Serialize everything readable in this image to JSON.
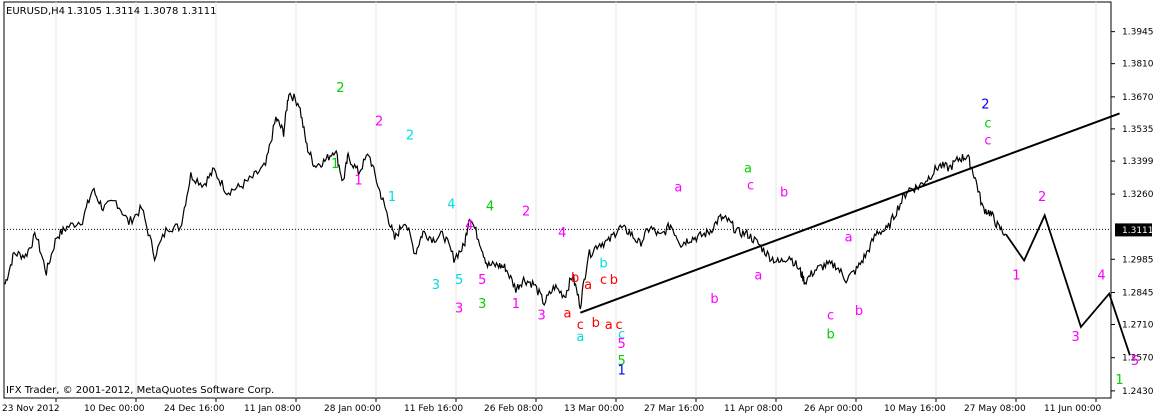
{
  "chart_data": {
    "type": "line",
    "header": {
      "symbol": "EURUSD,H4",
      "ohlc": "1.3105 1.3114 1.3078 1.3111"
    },
    "copyright": "IFX Trader, © 2001-2012, MetaQuotes Software Corp.",
    "current_price_label": "1.3111",
    "current_price": 1.3111,
    "ylim": [
      1.24,
      1.407
    ],
    "y_ticks": [
      "1.3945",
      "1.3810",
      "1.3670",
      "1.3535",
      "1.3399",
      "1.3260",
      "1.2985",
      "1.2845",
      "1.2710",
      "1.2570",
      "1.2430"
    ],
    "x_ticks": [
      "23 Nov 2012",
      "10 Dec 00:00",
      "24 Dec 16:00",
      "11 Jan 08:00",
      "28 Jan 00:00",
      "11 Feb 16:00",
      "26 Feb 08:00",
      "13 Mar 00:00",
      "27 Mar 16:00",
      "11 Apr 08:00",
      "26 Apr 00:00",
      "10 May 16:00",
      "27 May 08:00",
      "11 Jun 00:00"
    ],
    "x_count": 13.7,
    "price_path": [
      [
        0,
        1.288
      ],
      [
        0.35,
        1.301
      ],
      [
        0.8,
        1.3
      ],
      [
        1.2,
        1.309
      ],
      [
        1.6,
        1.293
      ],
      [
        2.0,
        1.308
      ],
      [
        2.4,
        1.312
      ],
      [
        3.0,
        1.315
      ],
      [
        3.4,
        1.328
      ],
      [
        3.8,
        1.32
      ],
      [
        4.3,
        1.323
      ],
      [
        4.8,
        1.314
      ],
      [
        5.3,
        1.32
      ],
      [
        5.8,
        1.3
      ],
      [
        6.3,
        1.312
      ],
      [
        6.8,
        1.312
      ],
      [
        7.2,
        1.334
      ],
      [
        7.7,
        1.33
      ],
      [
        8.1,
        1.336
      ],
      [
        8.6,
        1.327
      ],
      [
        9.1,
        1.329
      ],
      [
        9.6,
        1.333
      ],
      [
        10.1,
        1.338
      ],
      [
        10.5,
        1.358
      ],
      [
        10.8,
        1.352
      ],
      [
        11.0,
        1.369
      ],
      [
        11.4,
        1.364
      ],
      [
        11.7,
        1.346
      ],
      [
        12.0,
        1.338
      ],
      [
        12.4,
        1.34
      ],
      [
        12.8,
        1.345
      ],
      [
        13.1,
        1.331
      ],
      [
        13.3,
        1.342
      ],
      [
        13.7,
        1.335
      ],
      [
        14.1,
        1.343
      ],
      [
        14.5,
        1.328
      ],
      [
        14.8,
        1.318
      ],
      [
        15.1,
        1.307
      ],
      [
        15.5,
        1.315
      ],
      [
        15.9,
        1.301
      ],
      [
        16.2,
        1.31
      ],
      [
        16.6,
        1.307
      ],
      [
        17.0,
        1.309
      ],
      [
        17.4,
        1.299
      ],
      [
        17.8,
        1.304
      ],
      [
        18.0,
        1.317
      ],
      [
        18.4,
        1.306
      ],
      [
        18.7,
        1.296
      ],
      [
        19.1,
        1.296
      ],
      [
        19.4,
        1.295
      ],
      [
        19.8,
        1.286
      ],
      [
        20.1,
        1.29
      ],
      [
        20.5,
        1.288
      ],
      [
        20.9,
        1.28
      ],
      [
        21.3,
        1.287
      ],
      [
        21.7,
        1.283
      ],
      [
        22.0,
        1.292
      ],
      [
        22.3,
        1.279
      ],
      [
        22.6,
        1.3
      ],
      [
        23.0,
        1.305
      ],
      [
        23.4,
        1.306
      ],
      [
        23.8,
        1.312
      ],
      [
        24.2,
        1.31
      ],
      [
        24.6,
        1.305
      ],
      [
        25.0,
        1.312
      ],
      [
        25.4,
        1.308
      ],
      [
        25.8,
        1.313
      ],
      [
        26.2,
        1.305
      ],
      [
        26.5,
        1.307
      ],
      [
        26.9,
        1.308
      ],
      [
        27.3,
        1.31
      ],
      [
        27.7,
        1.316
      ],
      [
        28.0,
        1.315
      ],
      [
        28.4,
        1.31
      ],
      [
        28.8,
        1.309
      ],
      [
        29.2,
        1.305
      ],
      [
        29.6,
        1.3
      ],
      [
        30.0,
        1.297
      ],
      [
        30.4,
        1.3
      ],
      [
        30.8,
        1.294
      ],
      [
        31.0,
        1.289
      ],
      [
        31.4,
        1.294
      ],
      [
        31.8,
        1.296
      ],
      [
        32.2,
        1.296
      ],
      [
        32.6,
        1.29
      ],
      [
        33.0,
        1.294
      ],
      [
        33.4,
        1.301
      ],
      [
        33.8,
        1.31
      ],
      [
        34.2,
        1.311
      ],
      [
        34.6,
        1.32
      ],
      [
        35.0,
        1.328
      ],
      [
        35.4,
        1.329
      ],
      [
        35.8,
        1.333
      ],
      [
        36.2,
        1.338
      ],
      [
        36.6,
        1.337
      ],
      [
        37.0,
        1.341
      ],
      [
        37.3,
        1.342
      ],
      [
        37.6,
        1.333
      ],
      [
        37.9,
        1.32
      ],
      [
        38.2,
        1.318
      ],
      [
        38.5,
        1.312
      ],
      [
        38.8,
        1.309
      ]
    ],
    "projection_path": [
      [
        38.8,
        1.309
      ],
      [
        39.5,
        1.298
      ],
      [
        40.3,
        1.317
      ],
      [
        41.7,
        1.27
      ],
      [
        42.8,
        1.284
      ],
      [
        43.6,
        1.258
      ]
    ],
    "trendline": [
      [
        22.3,
        1.276
      ],
      [
        43.2,
        1.36
      ]
    ],
    "wave_labels": [
      {
        "t": "2",
        "x": 13.0,
        "y": 1.369,
        "c": "#00d000"
      },
      {
        "t": "1",
        "x": 12.8,
        "y": 1.337,
        "c": "#00d000"
      },
      {
        "t": "2",
        "x": 14.5,
        "y": 1.355,
        "c": "#ff00ff"
      },
      {
        "t": "1",
        "x": 13.7,
        "y": 1.33,
        "c": "#ff00ff"
      },
      {
        "t": "2",
        "x": 15.7,
        "y": 1.349,
        "c": "#00dddd"
      },
      {
        "t": "1",
        "x": 15.0,
        "y": 1.323,
        "c": "#00dddd"
      },
      {
        "t": "4",
        "x": 17.3,
        "y": 1.32,
        "c": "#00dddd"
      },
      {
        "t": "4",
        "x": 18.0,
        "y": 1.311,
        "c": "#ff00ff"
      },
      {
        "t": "4",
        "x": 18.8,
        "y": 1.319,
        "c": "#00d000"
      },
      {
        "t": "2",
        "x": 20.2,
        "y": 1.317,
        "c": "#ff00ff"
      },
      {
        "t": "4",
        "x": 21.6,
        "y": 1.308,
        "c": "#ff00ff"
      },
      {
        "t": "3",
        "x": 16.7,
        "y": 1.286,
        "c": "#00dddd"
      },
      {
        "t": "5",
        "x": 17.6,
        "y": 1.288,
        "c": "#00dddd"
      },
      {
        "t": "5",
        "x": 18.5,
        "y": 1.288,
        "c": "#ff00ff"
      },
      {
        "t": "3",
        "x": 17.6,
        "y": 1.276,
        "c": "#ff00ff"
      },
      {
        "t": "3",
        "x": 18.5,
        "y": 1.278,
        "c": "#00d000"
      },
      {
        "t": "1",
        "x": 19.8,
        "y": 1.278,
        "c": "#ff00ff"
      },
      {
        "t": "3",
        "x": 20.8,
        "y": 1.273,
        "c": "#ff00ff"
      },
      {
        "t": "b",
        "x": 22.1,
        "y": 1.289,
        "c": "#ff0000",
        "s": 11
      },
      {
        "t": "a",
        "x": 22.6,
        "y": 1.286,
        "c": "#ff0000",
        "s": 11
      },
      {
        "t": "a",
        "x": 21.8,
        "y": 1.274,
        "c": "#ff0000",
        "s": 11
      },
      {
        "t": "c",
        "x": 22.3,
        "y": 1.269,
        "c": "#ff0000",
        "s": 11
      },
      {
        "t": "b",
        "x": 22.9,
        "y": 1.27,
        "c": "#ff0000",
        "s": 11
      },
      {
        "t": "a",
        "x": 22.3,
        "y": 1.264,
        "c": "#00dddd"
      },
      {
        "t": "b",
        "x": 23.2,
        "y": 1.295,
        "c": "#00dddd"
      },
      {
        "t": "c",
        "x": 23.2,
        "y": 1.288,
        "c": "#ff0000",
        "s": 11
      },
      {
        "t": "b",
        "x": 23.6,
        "y": 1.288,
        "c": "#ff0000",
        "s": 11
      },
      {
        "t": "a",
        "x": 23.4,
        "y": 1.269,
        "c": "#ff0000",
        "s": 11
      },
      {
        "t": "c",
        "x": 23.8,
        "y": 1.269,
        "c": "#ff0000",
        "s": 11
      },
      {
        "t": "c",
        "x": 23.9,
        "y": 1.265,
        "c": "#00dddd"
      },
      {
        "t": "5",
        "x": 23.9,
        "y": 1.261,
        "c": "#ff00ff"
      },
      {
        "t": "5",
        "x": 23.9,
        "y": 1.254,
        "c": "#00d000"
      },
      {
        "t": "1",
        "x": 23.9,
        "y": 1.25,
        "c": "#0000ff",
        "s": 15
      },
      {
        "t": "a",
        "x": 26.1,
        "y": 1.327,
        "c": "#ff00ff"
      },
      {
        "t": "b",
        "x": 27.5,
        "y": 1.28,
        "c": "#ff00ff"
      },
      {
        "t": "a",
        "x": 28.8,
        "y": 1.335,
        "c": "#00d000"
      },
      {
        "t": "c",
        "x": 28.9,
        "y": 1.328,
        "c": "#ff00ff"
      },
      {
        "t": "a",
        "x": 29.2,
        "y": 1.29,
        "c": "#ff00ff"
      },
      {
        "t": "b",
        "x": 30.2,
        "y": 1.325,
        "c": "#ff00ff"
      },
      {
        "t": "a",
        "x": 32.7,
        "y": 1.306,
        "c": "#ff00ff"
      },
      {
        "t": "c",
        "x": 32.0,
        "y": 1.273,
        "c": "#ff00ff"
      },
      {
        "t": "b",
        "x": 33.1,
        "y": 1.275,
        "c": "#ff00ff"
      },
      {
        "t": "b",
        "x": 32.0,
        "y": 1.265,
        "c": "#00d000"
      },
      {
        "t": "2",
        "x": 38.0,
        "y": 1.362,
        "c": "#0000ff",
        "s": 15
      },
      {
        "t": "c",
        "x": 38.1,
        "y": 1.354,
        "c": "#00d000"
      },
      {
        "t": "c",
        "x": 38.1,
        "y": 1.347,
        "c": "#ff00ff"
      },
      {
        "t": "2",
        "x": 40.2,
        "y": 1.323,
        "c": "#ff00ff"
      },
      {
        "t": "1",
        "x": 39.2,
        "y": 1.29,
        "c": "#ff00ff"
      },
      {
        "t": "4",
        "x": 42.5,
        "y": 1.29,
        "c": "#ff00ff"
      },
      {
        "t": "3",
        "x": 41.5,
        "y": 1.264,
        "c": "#ff00ff"
      },
      {
        "t": "5",
        "x": 43.8,
        "y": 1.254,
        "c": "#ff00ff"
      },
      {
        "t": "1",
        "x": 43.2,
        "y": 1.246,
        "c": "#00d000",
        "s": 15
      }
    ]
  }
}
